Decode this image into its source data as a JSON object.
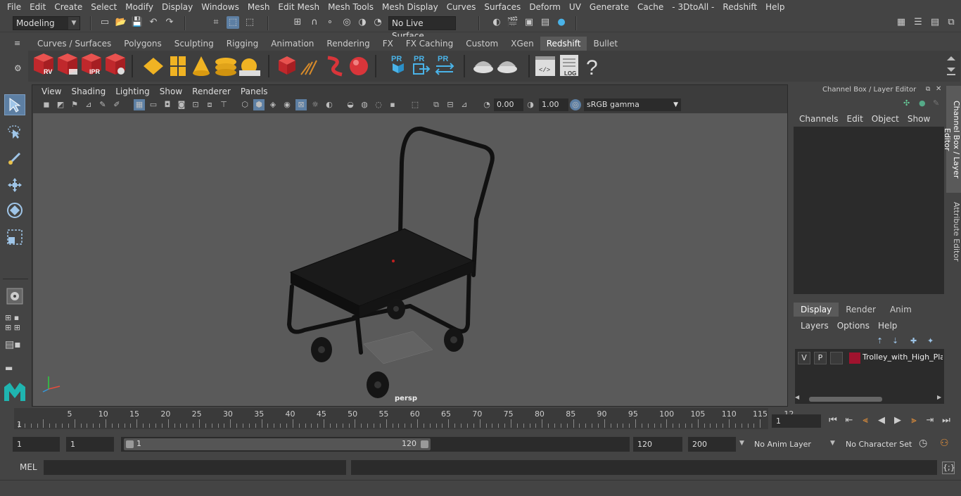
{
  "menubar": [
    "File",
    "Edit",
    "Create",
    "Select",
    "Modify",
    "Display",
    "Windows",
    "Mesh",
    "Edit Mesh",
    "Mesh Tools",
    "Mesh Display",
    "Curves",
    "Surfaces",
    "Deform",
    "UV",
    "Generate",
    "Cache",
    "- 3DtoAll -",
    "Redshift",
    "Help"
  ],
  "status": {
    "mode": "Modeling",
    "live_surface": "No Live Surface"
  },
  "shelf": {
    "tabs": [
      "Curves / Surfaces",
      "Polygons",
      "Sculpting",
      "Rigging",
      "Animation",
      "Rendering",
      "FX",
      "FX Caching",
      "Custom",
      "XGen",
      "Redshift",
      "Bullet"
    ],
    "active": "Redshift",
    "icon_labels": [
      "RV",
      "IPR",
      "PR",
      "PR",
      "PR",
      "LOG",
      "?"
    ]
  },
  "viewport": {
    "menu": [
      "View",
      "Shading",
      "Lighting",
      "Show",
      "Renderer",
      "Panels"
    ],
    "exposure": "0.00",
    "gamma": "1.00",
    "color_space": "sRGB gamma",
    "camera": "persp"
  },
  "right_panel": {
    "title": "Channel Box / Layer Editor",
    "channel_menu": [
      "Channels",
      "Edit",
      "Object",
      "Show"
    ],
    "layer_tabs": [
      "Display",
      "Render",
      "Anim"
    ],
    "layer_tab_active": "Display",
    "layer_menu": [
      "Layers",
      "Options",
      "Help"
    ],
    "layer": {
      "visible": "V",
      "playback": "P",
      "name": "Trolley_with_High_Platform",
      "color": "#a0132e"
    }
  },
  "side_tabs": [
    "Channel Box / Layer Editor",
    "Attribute Editor"
  ],
  "timeline": {
    "ticks": [
      "5",
      "10",
      "15",
      "20",
      "25",
      "30",
      "35",
      "40",
      "45",
      "50",
      "55",
      "60",
      "65",
      "70",
      "75",
      "80",
      "85",
      "90",
      "95",
      "100",
      "105",
      "110",
      "115",
      "12"
    ],
    "start_marker": "1",
    "current_frame": "1"
  },
  "range": {
    "start": "1",
    "playback_start": "1",
    "slider_start": "1",
    "slider_end": "120",
    "playback_end": "120",
    "end": "200",
    "anim_layer": "No Anim Layer",
    "character_set": "No Character Set"
  },
  "command": {
    "label": "MEL"
  },
  "colors": {
    "accent": "#5d7fa3",
    "background": "#444444",
    "viewport_bg": "#5a5a5a",
    "redshift_red": "#d9353a",
    "gold": "#f0b323"
  }
}
